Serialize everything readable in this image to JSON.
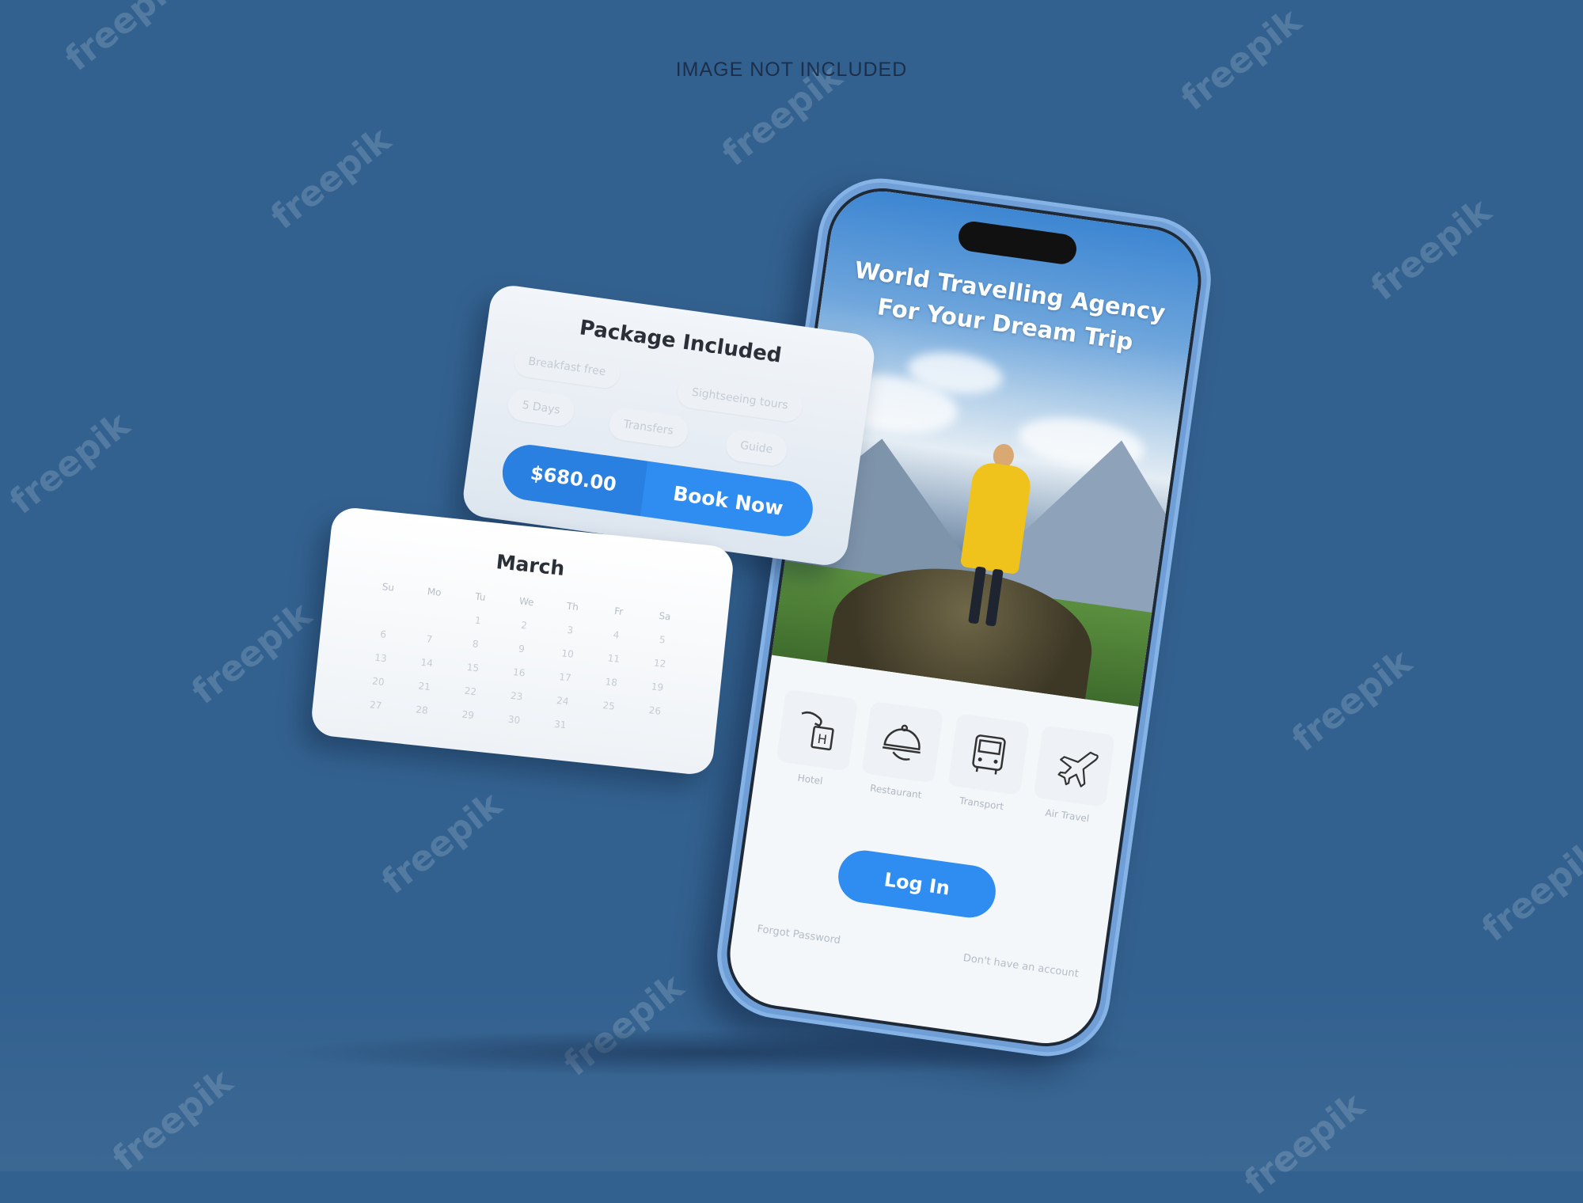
{
  "notice": "IMAGE NOT INCLUDED",
  "watermark": "freepik",
  "phone": {
    "headline_line1": "World Travelling Agency",
    "headline_line2": "For Your Dream Trip",
    "features": [
      {
        "label": "Hotel",
        "icon": "hotel-icon"
      },
      {
        "label": "Restaurant",
        "icon": "food-cloche-icon"
      },
      {
        "label": "Transport",
        "icon": "bus-icon"
      },
      {
        "label": "Air Travel",
        "icon": "airplane-icon"
      }
    ],
    "login_label": "Log In",
    "forgot_password": "Forgot Password",
    "signup_prompt": "Don't have an account"
  },
  "package": {
    "title": "Package Included",
    "chips": [
      "Breakfast free",
      "Sightseeing tours",
      "5 Days",
      "Transfers",
      "Guide"
    ],
    "price": "$680.00",
    "book_label": "Book Now"
  },
  "calendar": {
    "month": "March",
    "weekdays": [
      "Su",
      "Mo",
      "Tu",
      "We",
      "Th",
      "Fr",
      "Sa"
    ],
    "days": [
      "",
      "",
      "1",
      "2",
      "3",
      "4",
      "5",
      "6",
      "7",
      "8",
      "9",
      "10",
      "11",
      "12",
      "13",
      "14",
      "15",
      "16",
      "17",
      "18",
      "19",
      "20",
      "21",
      "22",
      "23",
      "24",
      "25",
      "26",
      "27",
      "28",
      "29",
      "30",
      "31",
      "",
      ""
    ]
  },
  "colors": {
    "background": "#33618f",
    "accent": "#2f8cf0",
    "phone_frame": "#6f9fd6",
    "coat": "#f0c21c"
  }
}
